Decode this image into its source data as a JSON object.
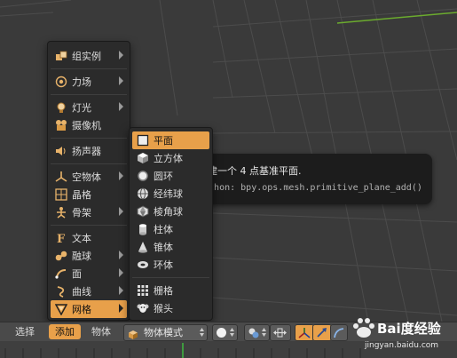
{
  "add_menu": {
    "items": [
      {
        "label": "组实例",
        "icon": "group-instance-icon",
        "submenu": true
      },
      {
        "label": "力场",
        "icon": "force-field-icon",
        "submenu": true
      },
      {
        "label": "灯光",
        "icon": "lamp-icon",
        "submenu": true
      },
      {
        "label": "摄像机",
        "icon": "camera-icon",
        "submenu": false
      },
      {
        "label": "扬声器",
        "icon": "speaker-icon",
        "submenu": false
      },
      {
        "label": "空物体",
        "icon": "empty-axes-icon",
        "submenu": true
      },
      {
        "label": "晶格",
        "icon": "lattice-icon",
        "submenu": false
      },
      {
        "label": "骨架",
        "icon": "armature-icon",
        "submenu": true
      },
      {
        "label": "文本",
        "icon": "text-icon",
        "submenu": false
      },
      {
        "label": "融球",
        "icon": "metaball-icon",
        "submenu": true
      },
      {
        "label": "面",
        "icon": "surface-icon",
        "submenu": true
      },
      {
        "label": "曲线",
        "icon": "curve-icon",
        "submenu": true
      },
      {
        "label": "网格",
        "icon": "mesh-icon",
        "submenu": true,
        "highlighted": true
      }
    ]
  },
  "mesh_submenu": {
    "items": [
      {
        "label": "平面",
        "icon": "plane-icon",
        "highlighted": true
      },
      {
        "label": "立方体",
        "icon": "cube-icon"
      },
      {
        "label": "圆环",
        "icon": "circle-icon"
      },
      {
        "label": "经纬球",
        "icon": "uv-sphere-icon"
      },
      {
        "label": "棱角球",
        "icon": "ico-sphere-icon"
      },
      {
        "label": "柱体",
        "icon": "cylinder-icon"
      },
      {
        "label": "锥体",
        "icon": "cone-icon"
      },
      {
        "label": "环体",
        "icon": "torus-icon"
      },
      {
        "label": "栅格",
        "icon": "grid-icon"
      },
      {
        "label": "猴头",
        "icon": "monkey-icon"
      }
    ]
  },
  "tooltip": {
    "title": "创建一个 4 点基准平面.",
    "python": "Python: bpy.ops.mesh.primitive_plane_add()"
  },
  "header": {
    "select": "选择",
    "add": "添加",
    "object": "物体",
    "mode": "物体模式"
  },
  "watermark": {
    "brand": "Bai度经验",
    "url": "jingyan.baidu.com"
  },
  "colors": {
    "highlight": "#e8a04a",
    "menu_bg": "#2b2b2b",
    "viewport_bg": "#3a3a3a",
    "x_axis": "#c94848",
    "y_axis": "#6bab2e"
  }
}
